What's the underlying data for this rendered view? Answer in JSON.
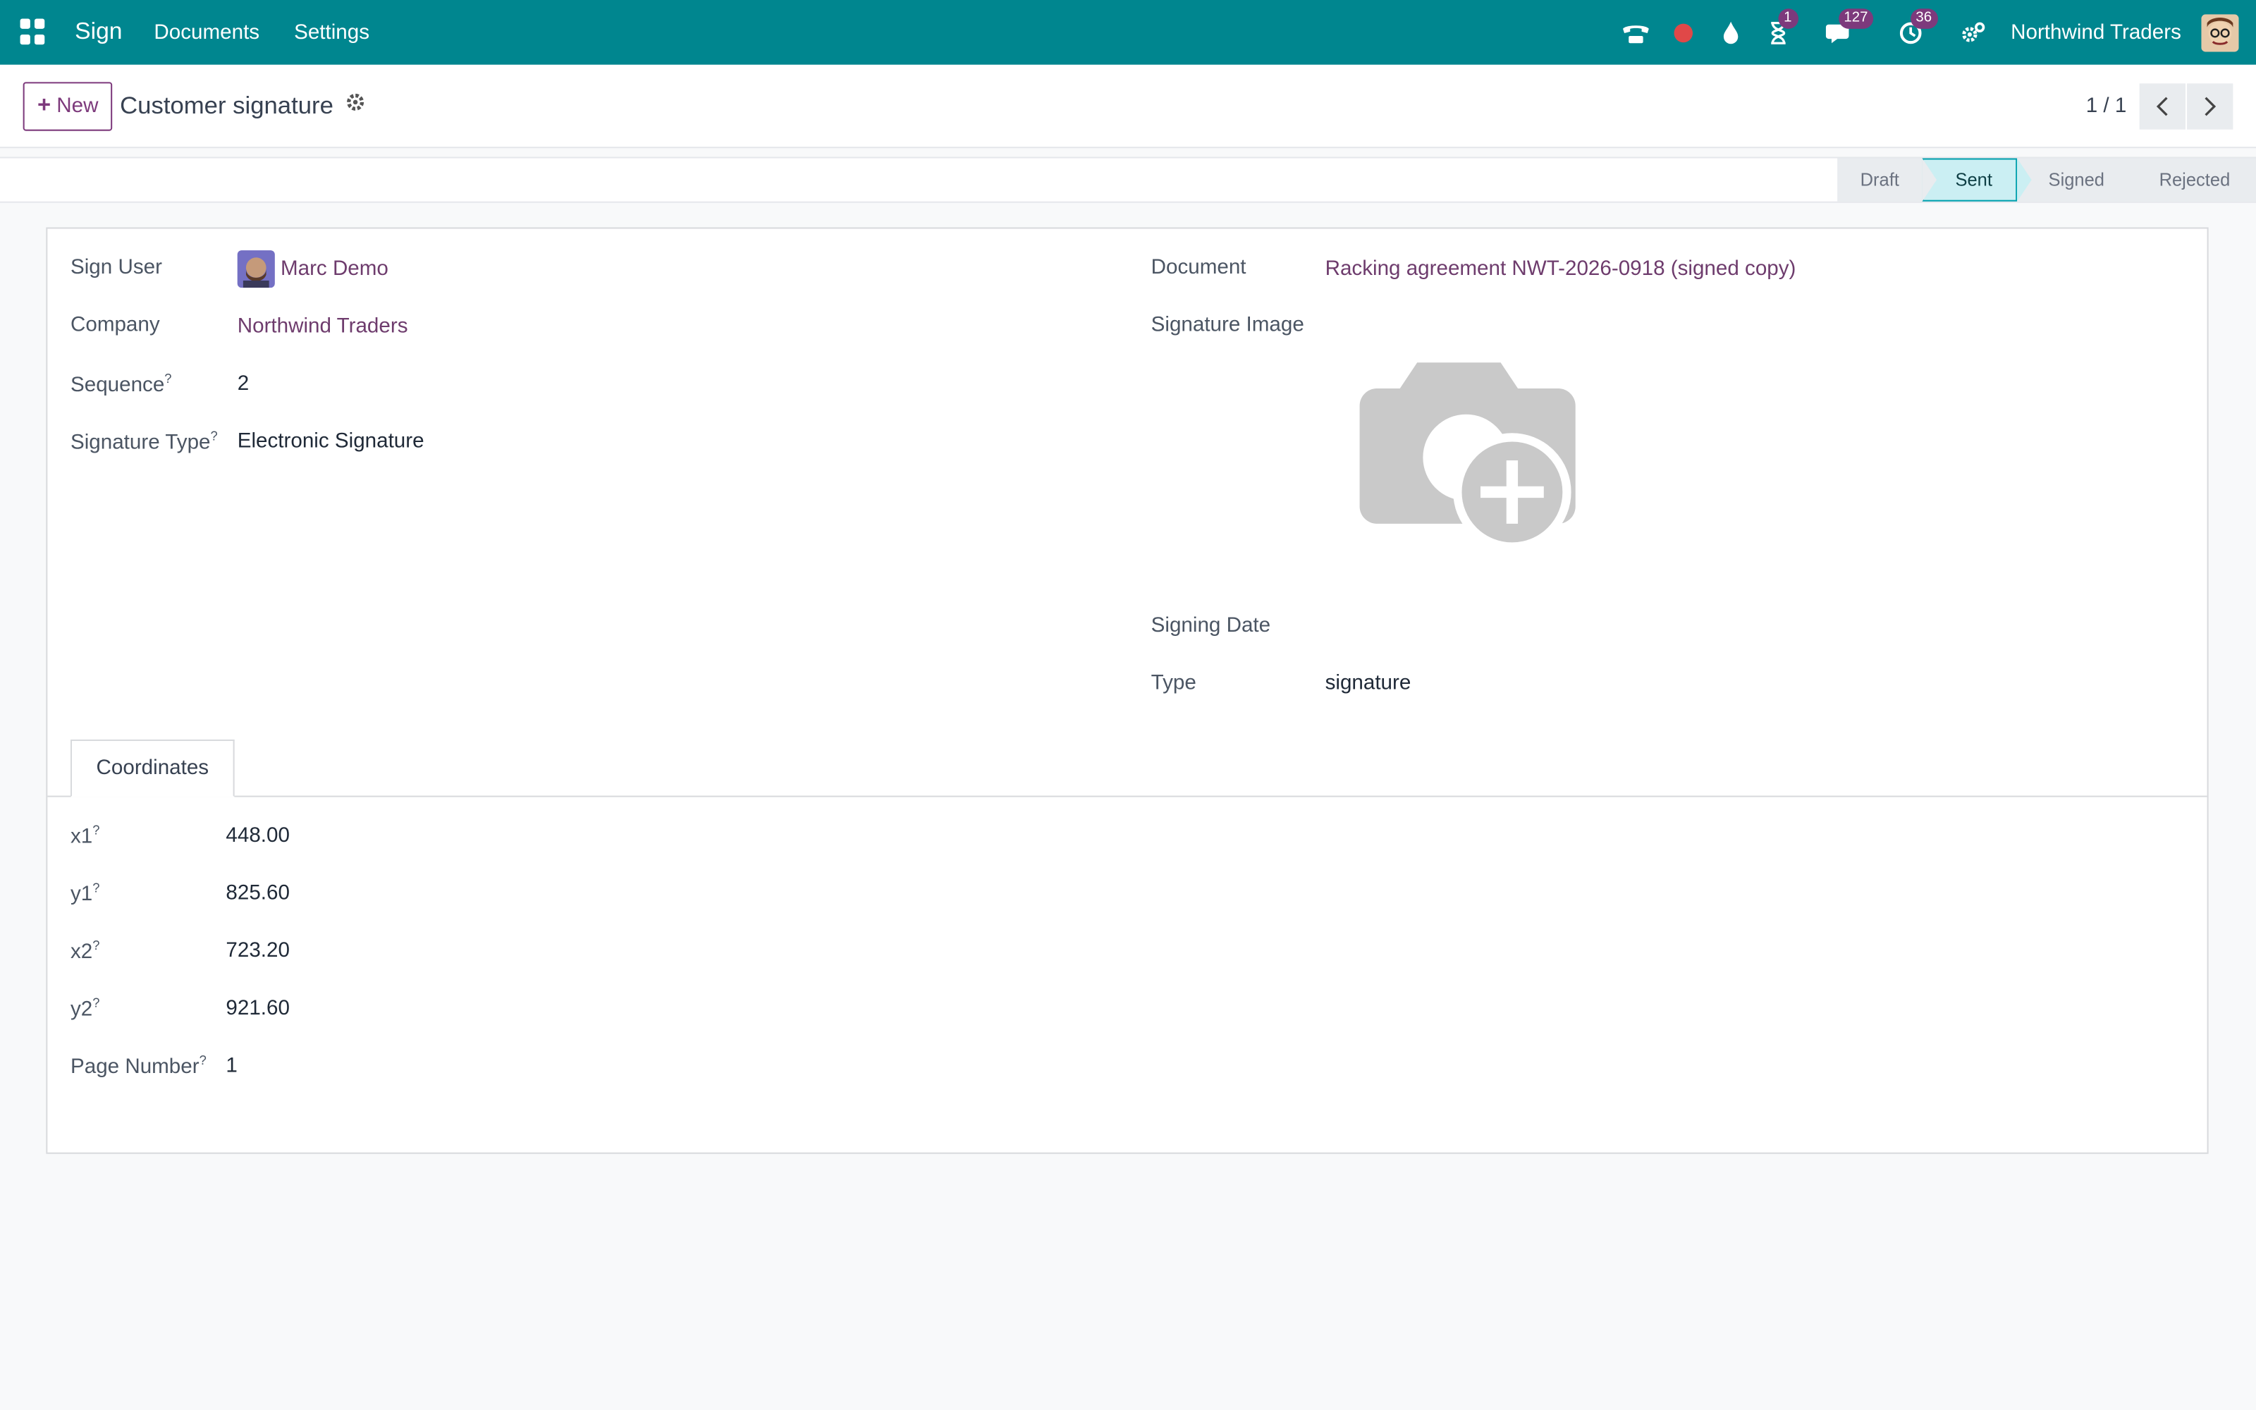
{
  "navbar": {
    "app": "Sign",
    "menu": [
      "Documents",
      "Settings"
    ],
    "badges": {
      "activities": "1",
      "messages": "127",
      "clock": "36"
    },
    "company": "Northwind Traders"
  },
  "control": {
    "new_label": "New",
    "title": "Customer signature",
    "pager": "1 / 1"
  },
  "status": {
    "stages": [
      "Draft",
      "Sent",
      "Signed",
      "Rejected"
    ],
    "active": "Sent"
  },
  "form": {
    "left": {
      "sign_user_label": "Sign User",
      "sign_user": "Marc Demo",
      "company_label": "Company",
      "company": "Northwind Traders",
      "sequence_label": "Sequence",
      "sequence": "2",
      "signature_type_label": "Signature Type",
      "signature_type": "Electronic Signature"
    },
    "right": {
      "document_label": "Document",
      "document": "Racking agreement NWT-2026-0918 (signed copy)",
      "signature_image_label": "Signature Image",
      "signing_date_label": "Signing Date",
      "type_label": "Type",
      "type": "signature"
    },
    "tab_coordinates": "Coordinates",
    "coords": {
      "x1_label": "x1",
      "x1": "448.00",
      "y1_label": "y1",
      "y1": "825.60",
      "x2_label": "x2",
      "x2": "723.20",
      "y2_label": "y2",
      "y2": "921.60",
      "page_label": "Page Number",
      "page": "1"
    }
  },
  "colors": {
    "navbar": "#00868f",
    "accent": "#7d3a7c",
    "active_stage": "#cbeff3"
  },
  "tooltip_marker": "?"
}
